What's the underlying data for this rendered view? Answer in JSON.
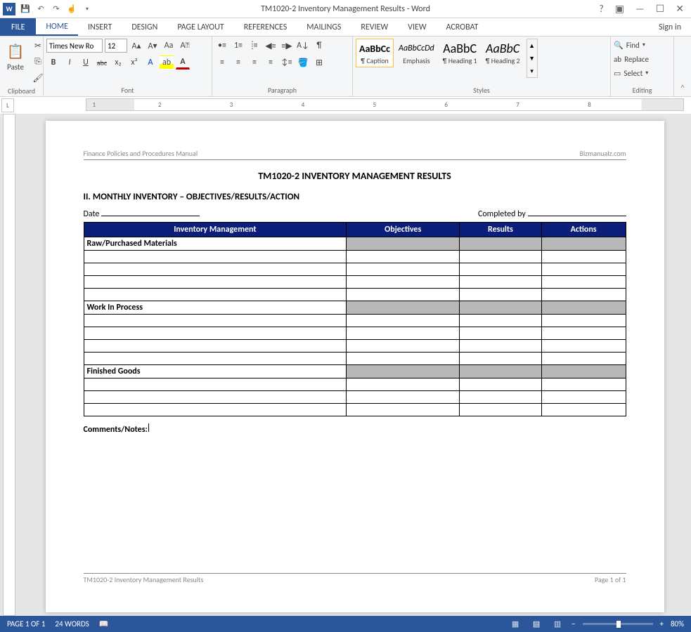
{
  "titlebar": {
    "title": "TM1020-2 Inventory Management Results - Word",
    "help_tip": "?",
    "ribbon_opts": "▣",
    "min": "—",
    "max": "☐",
    "close": "✕"
  },
  "tabs": {
    "file": "FILE",
    "home": "HOME",
    "insert": "INSERT",
    "design": "DESIGN",
    "page_layout": "PAGE LAYOUT",
    "references": "REFERENCES",
    "mailings": "MAILINGS",
    "review": "REVIEW",
    "view": "VIEW",
    "acrobat": "ACROBAT",
    "signin": "Sign in"
  },
  "ribbon": {
    "clipboard": {
      "label": "Clipboard",
      "paste": "Paste"
    },
    "font": {
      "label": "Font",
      "name": "Times New Ro",
      "size": "12",
      "bold": "B",
      "italic": "I",
      "underline": "U",
      "strike": "abc",
      "sub": "x₂",
      "sup": "x²"
    },
    "paragraph": {
      "label": "Paragraph"
    },
    "styles": {
      "label": "Styles",
      "items": [
        {
          "preview": "AaBbCc",
          "name": "¶ Caption",
          "weight": "bold"
        },
        {
          "preview": "AaBbCcDd",
          "name": "Emphasis",
          "style": "italic"
        },
        {
          "preview": "AaBbC",
          "name": "¶ Heading 1",
          "weight": "normal",
          "big": true
        },
        {
          "preview": "AaBbC",
          "name": "¶ Heading 2",
          "style": "italic",
          "big": true
        }
      ]
    },
    "editing": {
      "label": "Editing",
      "find": "Find",
      "replace": "Replace",
      "select": "Select"
    }
  },
  "ruler": {
    "marks": [
      "1",
      "2",
      "3",
      "4",
      "5",
      "6",
      "7",
      "8"
    ]
  },
  "document": {
    "header_left": "Finance Policies and Procedures Manual",
    "header_right": "Bizmanualz.com",
    "title": "TM1020-2 INVENTORY MANAGEMENT RESULTS",
    "section": "II. MONTHLY INVENTORY – OBJECTIVES/RESULTS/ACTION",
    "date_label": "Date",
    "completed_label": "Completed by",
    "table": {
      "headers": [
        "Inventory Management",
        "Objectives",
        "Results",
        "Actions"
      ],
      "categories": [
        "Raw/Purchased Materials",
        "Work In Process",
        "Finished Goods"
      ]
    },
    "comments": "Comments/Notes:",
    "footer_left": "TM1020-2 Inventory Management Results",
    "footer_right": "Page 1 of 1"
  },
  "statusbar": {
    "page": "PAGE 1 OF 1",
    "words": "24 WORDS",
    "zoom": "80%"
  }
}
